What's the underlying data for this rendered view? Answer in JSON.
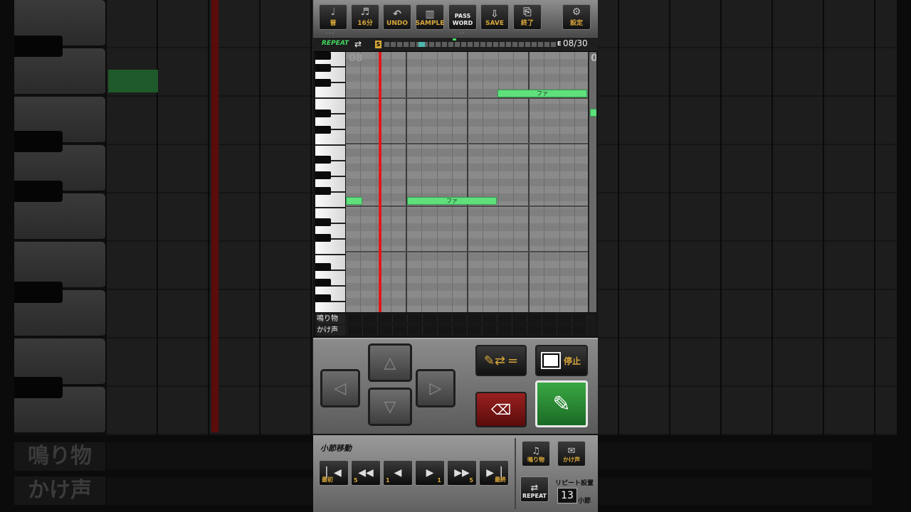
{
  "background": {
    "labels": [
      "鳴り物",
      "かけ声"
    ]
  },
  "toolbar": {
    "buttons": [
      {
        "label": "普",
        "icon": "note-icon"
      },
      {
        "label": "16分",
        "icon": "sixteenth-note-icon"
      },
      {
        "label": "UNDO",
        "icon": "undo-icon"
      },
      {
        "label": "SAMPLE",
        "icon": "piano-icon"
      },
      {
        "label": "PASS WORD",
        "icon": "password-icon"
      },
      {
        "label": "SAVE",
        "icon": "save-icon"
      },
      {
        "label": "終了",
        "icon": "exit-icon"
      },
      {
        "label": "設定",
        "icon": "gear-icon"
      }
    ]
  },
  "repeat_bar": {
    "repeat_label": "REPEAT",
    "start_marker": "S",
    "end_marker": "E",
    "measure": "08/30"
  },
  "roll": {
    "measure_label": "08",
    "next_measure_label": "0",
    "notes": [
      {
        "label": "ファ"
      },
      {
        "label": ""
      },
      {
        "label": "ファ"
      }
    ]
  },
  "lanes": {
    "narimono": "鳴り物",
    "kakegoe": "かけ声"
  },
  "controls": {
    "stop_label": "停止",
    "swap_label": "="
  },
  "bottom": {
    "heading": "小節移動",
    "nav_buttons": [
      {
        "label": "最初",
        "icon": "first-icon"
      },
      {
        "label": "5",
        "icon": "rewind-icon"
      },
      {
        "label": "1",
        "icon": "prev-icon"
      },
      {
        "label": "1",
        "icon": "next-icon"
      },
      {
        "label": "5",
        "icon": "fast-forward-icon"
      },
      {
        "label": "最終",
        "icon": "last-icon"
      }
    ],
    "narimono_label": "鳴り物",
    "kakegoe_label": "かけ声",
    "repeat_label": "REPEAT",
    "repeat_setting_label": "リピート設置",
    "repeat_value": "13",
    "repeat_unit": "小節"
  }
}
